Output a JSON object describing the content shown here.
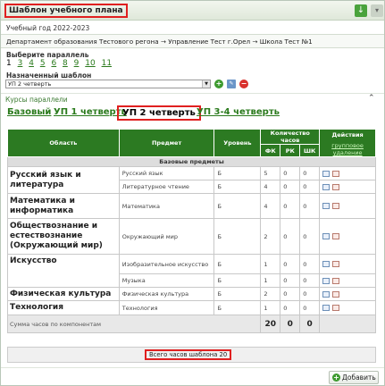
{
  "header": {
    "title": "Шаблон учебного плана"
  },
  "year": "Учебный год 2022-2023",
  "breadcrumb": "Департамент образования Тестового регона → Управление Тест г.Орел → Школа Тест №1",
  "parallel": {
    "label": "Выберите параллель",
    "items": [
      "1",
      "3",
      "4",
      "5",
      "6",
      "8",
      "9",
      "10",
      "11"
    ],
    "selected": "1"
  },
  "template": {
    "label": "Назначенный шаблон",
    "value": "УП 2 четверть"
  },
  "section": {
    "title": "Курсы параллели",
    "collapse_icon": "chevron-up"
  },
  "tabs": [
    "Базовый",
    "УП 1 четверть",
    "УП 2 четверть",
    "УП 3-4 четверть"
  ],
  "active_tab": "УП 2 четверть",
  "table": {
    "headers": {
      "area": "Область",
      "subject": "Предмет",
      "level": "Уровень",
      "hours": "Количество часов",
      "fk": "ФК",
      "rk": "РК",
      "shk": "ШК",
      "actions": "Действия",
      "group_delete": "групповое удаление"
    },
    "group": "Базовые предметы",
    "rows": [
      {
        "area": "Русский язык и литература",
        "subject": "Русский язык",
        "level": "Б",
        "fk": "5",
        "rk": "0",
        "shk": "0"
      },
      {
        "area": "",
        "subject": "Литературное чтение",
        "level": "Б",
        "fk": "4",
        "rk": "0",
        "shk": "0"
      },
      {
        "area": "Математика и информатика",
        "subject": "Математика",
        "level": "Б",
        "fk": "4",
        "rk": "0",
        "shk": "0"
      },
      {
        "area": "Обществознание и естествознание (Окружающий мир)",
        "subject": "Окружающий мир",
        "level": "Б",
        "fk": "2",
        "rk": "0",
        "shk": "0"
      },
      {
        "area": "Искусство",
        "subject": "Изобразительное искусство",
        "level": "Б",
        "fk": "1",
        "rk": "0",
        "shk": "0"
      },
      {
        "area": "",
        "subject": "Музыка",
        "level": "Б",
        "fk": "1",
        "rk": "0",
        "shk": "0"
      },
      {
        "area": "Физическая культура",
        "subject": "Физическая культура",
        "level": "Б",
        "fk": "2",
        "rk": "0",
        "shk": "0"
      },
      {
        "area": "Технология",
        "subject": "Технология",
        "level": "Б",
        "fk": "1",
        "rk": "0",
        "shk": "0"
      }
    ],
    "sum": {
      "label": "Сумма часов по компонентам",
      "fk": "20",
      "rk": "0",
      "shk": "0"
    }
  },
  "total": "Всего часов шаблона 20",
  "add_button": "Добавить",
  "colors": {
    "accent": "#2c7a22",
    "highlight": "#e02020"
  }
}
